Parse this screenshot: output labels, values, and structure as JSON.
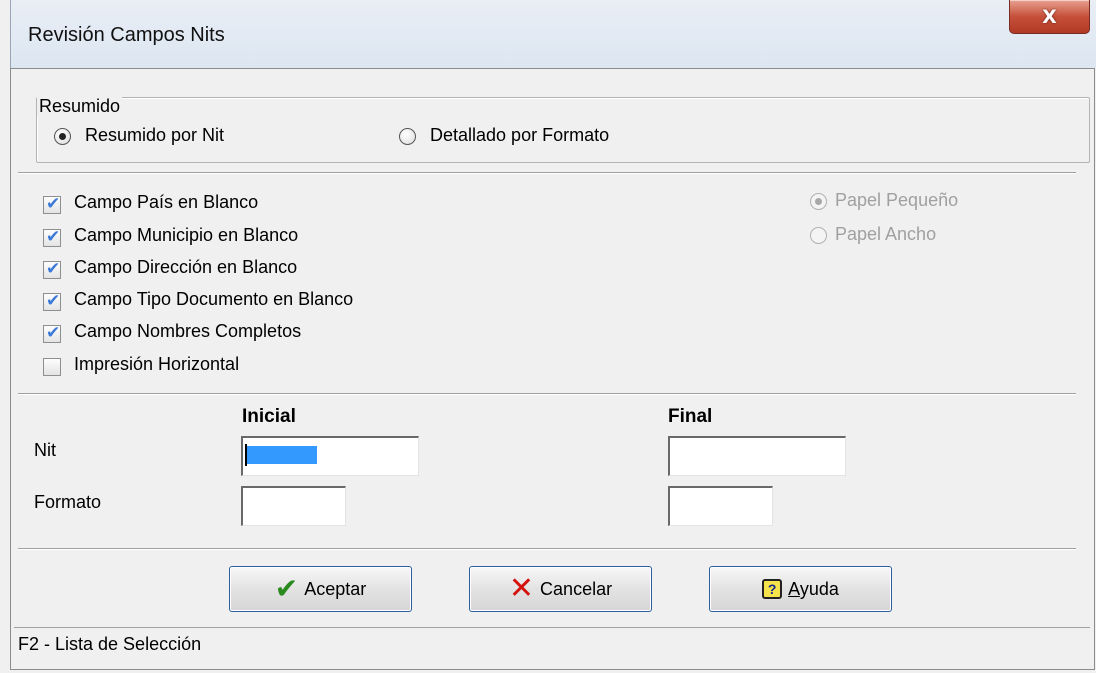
{
  "window": {
    "title": "Revisión Campos Nits",
    "close_label": "X"
  },
  "summary_group": {
    "legend": "Resumido",
    "options": [
      {
        "label": "Resumido por Nit",
        "selected": true
      },
      {
        "label": "Detallado por Formato",
        "selected": false
      }
    ]
  },
  "checks": [
    {
      "label": "Campo País en Blanco",
      "checked": true
    },
    {
      "label": "Campo Municipio en Blanco",
      "checked": true
    },
    {
      "label": "Campo Dirección en Blanco",
      "checked": true
    },
    {
      "label": "Campo Tipo Documento en Blanco",
      "checked": true
    },
    {
      "label": "Campo Nombres Completos",
      "checked": true
    },
    {
      "label": "Impresión Horizontal",
      "checked": false
    }
  ],
  "paper": {
    "options": [
      {
        "label": "Papel Pequeño",
        "selected": true,
        "enabled": false
      },
      {
        "label": "Papel Ancho",
        "selected": false,
        "enabled": false
      }
    ]
  },
  "range": {
    "col_initial": "Inicial",
    "col_final": "Final",
    "rows": [
      {
        "label": "Nit",
        "initial_value": "",
        "final_value": ""
      },
      {
        "label": "Formato",
        "initial_value": "",
        "final_value": ""
      }
    ]
  },
  "buttons": {
    "accept": "Aceptar",
    "cancel": "Cancelar",
    "help": "Ayuda"
  },
  "status": "F2 - Lista de Selección"
}
